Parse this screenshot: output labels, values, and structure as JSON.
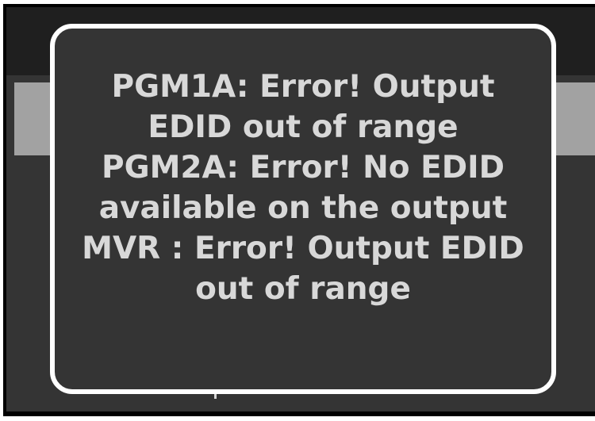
{
  "dialog": {
    "lines": [
      "PGM1A: Error! Output",
      "EDID out of range",
      "PGM2A: Error! No EDID",
      "available on the output",
      "MVR : Error! Output EDID",
      "out of range"
    ]
  }
}
